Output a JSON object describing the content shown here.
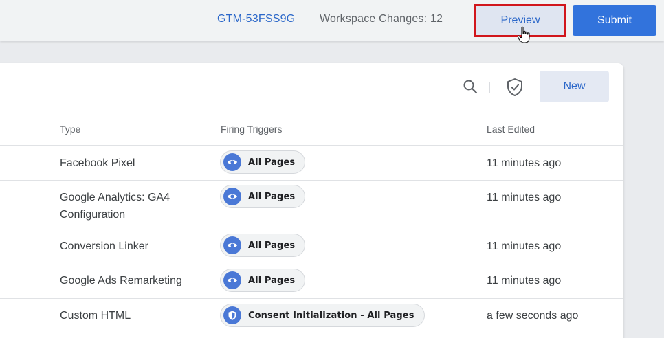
{
  "header": {
    "container_id": "GTM-53FSS9G",
    "workspace_changes": "Workspace Changes: 12",
    "preview_label": "Preview",
    "submit_label": "Submit"
  },
  "toolbar": {
    "new_label": "New",
    "search_icon": "search-icon",
    "shield_icon": "shield-check-icon"
  },
  "table": {
    "columns": [
      "Type",
      "Firing Triggers",
      "Last Edited"
    ],
    "rows": [
      {
        "type": "Facebook Pixel",
        "type_line2": "",
        "trigger": "All Pages",
        "trigger_icon": "eye-icon",
        "edited": "11 minutes ago"
      },
      {
        "type": "Google Analytics: GA4",
        "type_line2": "Configuration",
        "trigger": "All Pages",
        "trigger_icon": "eye-icon",
        "edited": "11 minutes ago"
      },
      {
        "type": "Conversion Linker",
        "type_line2": "",
        "trigger": "All Pages",
        "trigger_icon": "eye-icon",
        "edited": "11 minutes ago"
      },
      {
        "type": "Google Ads Remarketing",
        "type_line2": "",
        "trigger": "All Pages",
        "trigger_icon": "eye-icon",
        "edited": "11 minutes ago"
      },
      {
        "type": "Custom HTML",
        "type_line2": "",
        "trigger": "Consent Initialization - All Pages",
        "trigger_icon": "shield-icon",
        "edited": "a few seconds ago"
      }
    ]
  },
  "colors": {
    "accent": "#2b67c9",
    "submit": "#3273dc",
    "highlight": "#d1161c",
    "chip_icon": "#4a78d6"
  }
}
